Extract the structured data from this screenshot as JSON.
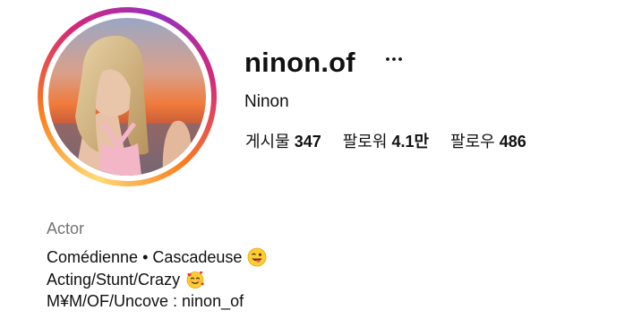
{
  "profile": {
    "username": "ninon.of",
    "full_name": "Ninon",
    "category": "Actor"
  },
  "stats": [
    {
      "label": "게시물",
      "value": "347"
    },
    {
      "label": "팔로워",
      "value": "4.1만"
    },
    {
      "label": "팔로우",
      "value": "486"
    }
  ],
  "bio": {
    "line1": "Comédienne • Cascadeuse",
    "line1_emoji": "winking-face-with-tongue-icon",
    "line2": "Acting/Stunt/Crazy",
    "line2_emoji": "smiling-face-with-hearts-icon",
    "line3": "M¥M/OF/Uncove : ninon_of"
  },
  "colors": {
    "ring_gradient": [
      "#feda75",
      "#fa7e1e",
      "#d62976",
      "#962fbf"
    ],
    "category_text": "#737373",
    "primary_text": "#111111"
  },
  "icons": {
    "more_options": "more-options-icon"
  }
}
